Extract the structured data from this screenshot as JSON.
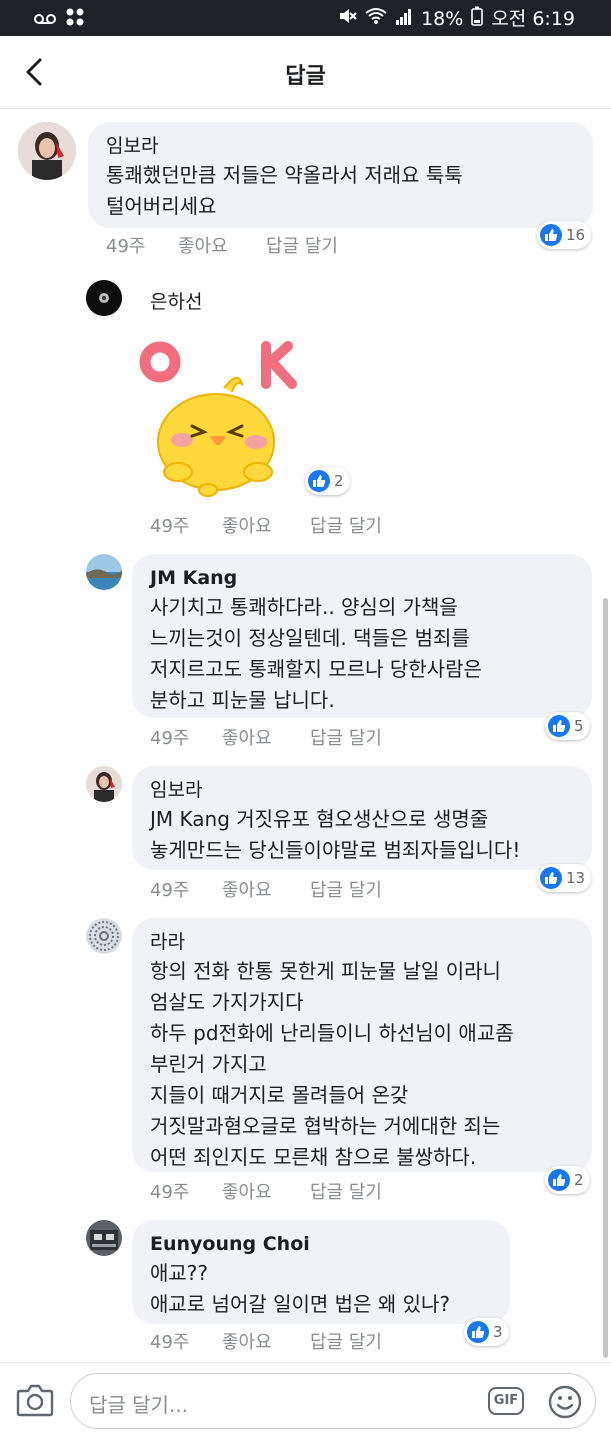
{
  "status_bar": {
    "battery": "18%",
    "time": "오전 6:19"
  },
  "header": {
    "title": "답글"
  },
  "comments": [
    {
      "author": "임보라",
      "text": "통쾌했던만큼 저들은 약올라서 저래요 툭툭\n털어버리세요",
      "time": "49주",
      "like_label": "좋아요",
      "reply_label": "답글 달기",
      "reactions": "16"
    },
    {
      "author": "은하선",
      "sticker": {
        "letters": [
          "O",
          "K"
        ],
        "description": "yellow chick sticker"
      },
      "time": "49주",
      "like_label": "좋아요",
      "reply_label": "답글 달기",
      "reactions": "2"
    },
    {
      "author": "JM Kang",
      "text": "사기치고 통쾌하다라.. 양심의 가책을\n느끼는것이 정상일텐데. 댁들은 범죄를\n저지르고도 통쾌할지 모르나 당한사람은\n분하고 피눈물 납니다.",
      "time": "49주",
      "like_label": "좋아요",
      "reply_label": "답글 달기",
      "reactions": "5"
    },
    {
      "author": "임보라",
      "text": "JM Kang 거짓유포 혐오생산으로 생명줄\n놓게만드는 당신들이야말로 범죄자들입니다!",
      "time": "49주",
      "like_label": "좋아요",
      "reply_label": "답글 달기",
      "reactions": "13"
    },
    {
      "author": "라라",
      "text": "항의 전화 한통 못한게 피눈물  날일 이라니\n엄살도 가지가지다\n하두 pd전화에 난리들이니 하선님이 애교좀\n부린거 가지고\n지들이 때거지로 몰려들어 온갖\n거짓말과혐오글로 협박하는 거에대한 죄는\n어떤 죄인지도 모른채 참으로 불쌍하다.",
      "time": "49주",
      "like_label": "좋아요",
      "reply_label": "답글 달기",
      "reactions": "2"
    },
    {
      "author": "Eunyoung Choi",
      "text": "애교??\n애교로 넘어갈 일이면 법은 왜 있나?",
      "time": "49주",
      "like_label": "좋아요",
      "reply_label": "답글 달기",
      "reactions": "3"
    }
  ],
  "composer": {
    "placeholder": "답글 달기...",
    "gif_label": "GIF"
  },
  "colors": {
    "like_blue": "#1877f2",
    "bubble_bg": "#f0f2f5",
    "meta_gray": "#8a8d91",
    "status_bar_bg": "#1e2126",
    "sticker_pink": "#f26d7d",
    "sticker_yellow": "#ffd93b"
  },
  "icons": [
    "voicemail-icon",
    "dots-icon",
    "mute-icon",
    "wifi-icon",
    "signal-icon",
    "battery-icon",
    "back-arrow-icon",
    "like-thumb-icon",
    "camera-icon",
    "emoji-icon"
  ]
}
